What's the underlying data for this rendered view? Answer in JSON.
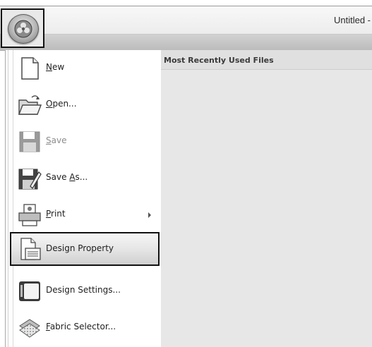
{
  "window": {
    "title": "Untitled -"
  },
  "app_button": {
    "icon": "application-orb-icon"
  },
  "menu": {
    "items": [
      {
        "key": "new",
        "pre": "",
        "mnemonic": "N",
        "post": "ew",
        "icon": "new-document-icon",
        "enabled": true,
        "has_submenu": false
      },
      {
        "key": "open",
        "pre": "",
        "mnemonic": "O",
        "post": "pen...",
        "icon": "open-folder-icon",
        "enabled": true,
        "has_submenu": false
      },
      {
        "key": "save",
        "pre": "",
        "mnemonic": "S",
        "post": "ave",
        "icon": "save-floppy-icon",
        "enabled": false,
        "has_submenu": false
      },
      {
        "key": "save-as",
        "pre": "Save ",
        "mnemonic": "A",
        "post": "s...",
        "icon": "save-as-icon",
        "enabled": true,
        "has_submenu": false
      },
      {
        "key": "print",
        "pre": "",
        "mnemonic": "P",
        "post": "rint",
        "icon": "printer-icon",
        "enabled": true,
        "has_submenu": true
      },
      {
        "key": "design-property",
        "pre": "Design Property",
        "mnemonic": "",
        "post": "",
        "icon": "design-property-icon",
        "enabled": true,
        "has_submenu": false,
        "highlighted": true
      },
      {
        "key": "design-settings",
        "pre": "Design Settings...",
        "mnemonic": "",
        "post": "",
        "icon": "design-settings-icon",
        "enabled": true,
        "has_submenu": false
      },
      {
        "key": "fabric-selector",
        "pre": "",
        "mnemonic": "F",
        "post": "abric Selector...",
        "icon": "fabric-selector-icon",
        "enabled": true,
        "has_submenu": false
      }
    ]
  },
  "recent_files": {
    "header": "Most Recently Used Files",
    "files": []
  },
  "colors": {
    "highlight_border": "#111111",
    "disabled_text": "#8c8c8c",
    "pane_background": "#e7e7e7"
  }
}
